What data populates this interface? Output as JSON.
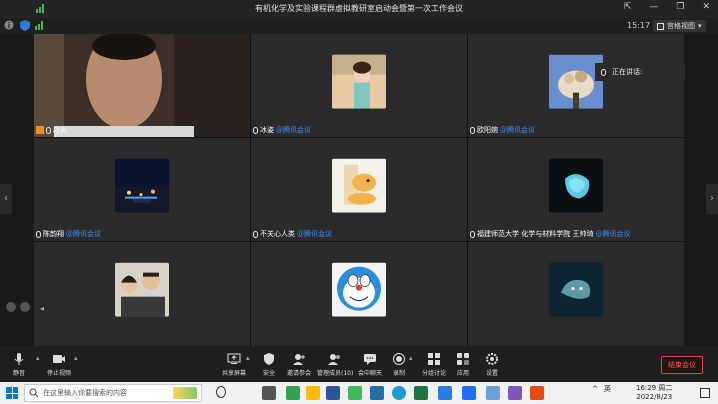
{
  "window": {
    "title": "有机化学及实验课程群虚拟教研室启动会暨第一次工作会议",
    "timer": "15:17",
    "gallery_view_label": "宫格视图"
  },
  "speaking": {
    "label": "正在讲话:"
  },
  "participants": [
    {
      "name": "赵炎",
      "source": ""
    },
    {
      "name": "冰姿",
      "source": "@腾讯会议"
    },
    {
      "name": "欧阳婉",
      "source": "@腾讯会议"
    },
    {
      "name": "陈韵翔",
      "source": "@腾讯会议"
    },
    {
      "name": "不关心人类",
      "source": "@腾讯会议"
    },
    {
      "name": "福建师范大学 化学与材料学院 王帅琦",
      "source": "@腾讯会议"
    },
    {
      "name": "",
      "source": ""
    },
    {
      "name": "",
      "source": ""
    },
    {
      "name": "",
      "source": ""
    }
  ],
  "toolbar": {
    "mute": "静音",
    "stop_video": "停止视频",
    "share": "共享屏幕",
    "security": "安全",
    "invite": "邀请参会",
    "manage": "管理成员(10)",
    "chat": "会中聊天",
    "record": "录制",
    "breakout": "分组讨论",
    "apps": "应用",
    "settings": "设置",
    "end": "结束会议"
  },
  "taskbar": {
    "search_placeholder": "在这里输入你要搜索的内容",
    "ime": "英",
    "time": "16:29 周二",
    "date": "2022/8/23"
  },
  "colors": {
    "accent": "#3b8cff",
    "end_red": "#ff5a4a",
    "bg": "#1a1a1a"
  }
}
